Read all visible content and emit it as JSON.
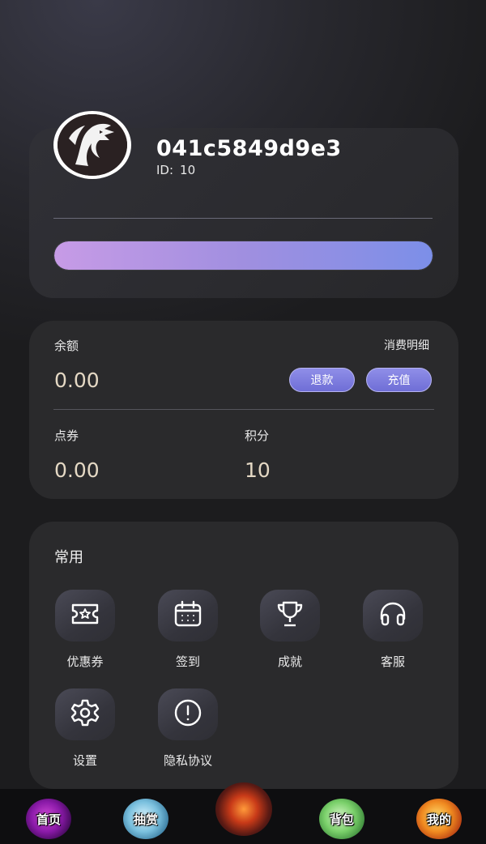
{
  "profile": {
    "username": "041c5849d9e3",
    "id_label": "ID:",
    "id_value": "10",
    "progress": 1.0
  },
  "balance": {
    "balance_label": "余额",
    "details_link": "消费明细",
    "balance_value": "0.00",
    "refund_button": "退款",
    "recharge_button": "充值",
    "coupon_points_label": "点券",
    "coupon_points_value": "0.00",
    "score_label": "积分",
    "score_value": "10"
  },
  "common": {
    "title": "常用",
    "items": [
      {
        "label": "优惠券",
        "icon": "ticket-icon"
      },
      {
        "label": "签到",
        "icon": "calendar-icon"
      },
      {
        "label": "成就",
        "icon": "trophy-icon"
      },
      {
        "label": "客服",
        "icon": "headphones-icon"
      },
      {
        "label": "设置",
        "icon": "gear-icon"
      },
      {
        "label": "隐私协议",
        "icon": "exclamation-circle-icon"
      }
    ]
  },
  "nav": {
    "items": [
      {
        "label": "首页",
        "icon": "home-orb-icon"
      },
      {
        "label": "抽赏",
        "icon": "draw-orb-icon"
      },
      {
        "label": "",
        "icon": "dragon-emblem-icon"
      },
      {
        "label": "背包",
        "icon": "bag-orb-icon"
      },
      {
        "label": "我的",
        "icon": "mine-orb-icon"
      }
    ]
  },
  "colors": {
    "background": "#1c1c1e",
    "card": "#2a2a2c",
    "accent_start": "#c79be6",
    "accent_end": "#7c8fe8",
    "value_text": "#e4d8c4"
  }
}
